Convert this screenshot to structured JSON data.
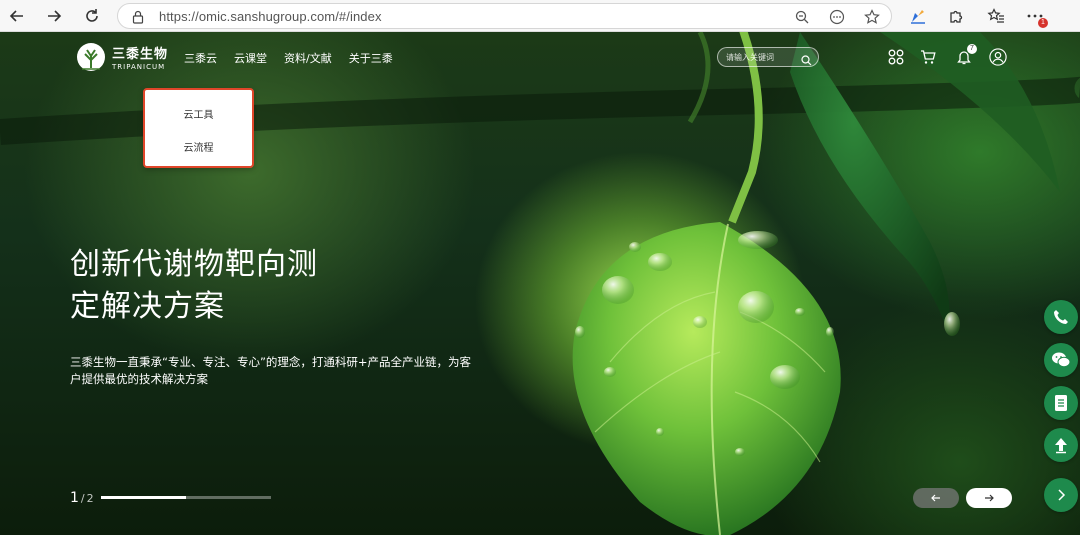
{
  "browser": {
    "url": "https://omic.sanshugroup.com/#/index",
    "extension_badge": "1"
  },
  "site": {
    "logo_cn": "三黍生物",
    "logo_en": "TRIPANICUM",
    "nav": [
      {
        "label": "三黍云"
      },
      {
        "label": "云课堂"
      },
      {
        "label": "资料/文献"
      },
      {
        "label": "关于三黍"
      }
    ],
    "search_placeholder": "请输入关键词",
    "notification_count": "7",
    "dropdown": [
      {
        "label": "云工具"
      },
      {
        "label": "云流程"
      }
    ]
  },
  "hero": {
    "title_line1": "创新代谢物靶向测",
    "title_line2": "定解决方案",
    "subtitle": "三黍生物一直秉承“专业、专注、专心”的理念，打通科研+产品全产业链，为客户提供最优的技术解决方案",
    "current_slide": "1",
    "separator": "/",
    "total_slides": "2",
    "progress": 0.5
  },
  "side_buttons": [
    {
      "icon": "phone-icon"
    },
    {
      "icon": "wechat-icon"
    },
    {
      "icon": "document-icon"
    },
    {
      "icon": "upload-icon"
    },
    {
      "icon": "chevron-right-icon"
    }
  ],
  "colors": {
    "accent_green": "#1e8a4c",
    "dropdown_border": "#e0462a"
  }
}
